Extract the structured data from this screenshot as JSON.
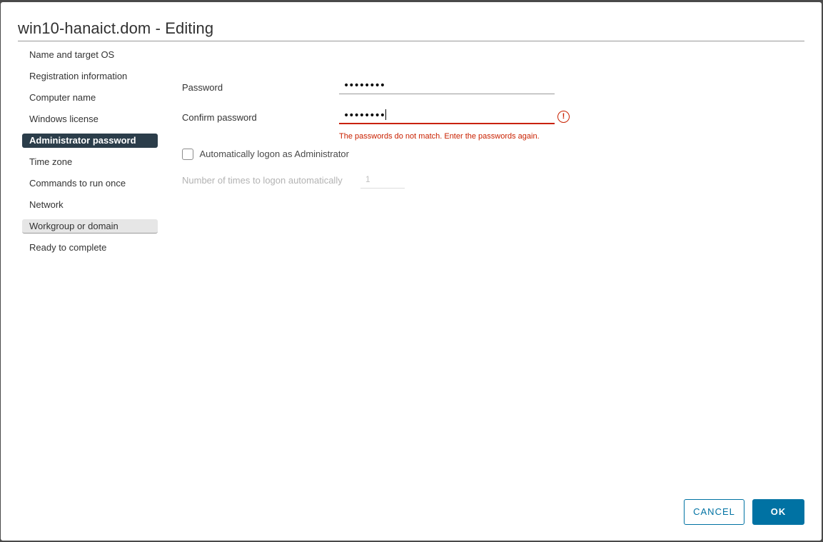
{
  "dialog": {
    "title": "win10-hanaict.dom - Editing"
  },
  "nav": {
    "items": [
      {
        "label": "Name and target OS",
        "state": "normal"
      },
      {
        "label": "Registration information",
        "state": "normal"
      },
      {
        "label": "Computer name",
        "state": "normal"
      },
      {
        "label": "Windows license",
        "state": "normal"
      },
      {
        "label": "Administrator password",
        "state": "active"
      },
      {
        "label": "Time zone",
        "state": "normal"
      },
      {
        "label": "Commands to run once",
        "state": "normal"
      },
      {
        "label": "Network",
        "state": "normal"
      },
      {
        "label": "Workgroup or domain",
        "state": "hover"
      },
      {
        "label": "Ready to complete",
        "state": "normal"
      }
    ]
  },
  "form": {
    "password": {
      "label": "Password",
      "value": "••••••••"
    },
    "confirm": {
      "label": "Confirm password",
      "value": "••••••••",
      "error_icon": "!",
      "error": "The passwords do not match. Enter the passwords again."
    },
    "autologon": {
      "label": "Automatically logon as Administrator",
      "checked": false
    },
    "logon_count": {
      "label": "Number of times to logon automatically",
      "value": "1",
      "disabled": true
    }
  },
  "footer": {
    "cancel_label": "CANCEL",
    "ok_label": "OK"
  },
  "colors": {
    "accent": "#0072a3",
    "error": "#c92100",
    "nav_active": "#2b3d4a"
  }
}
